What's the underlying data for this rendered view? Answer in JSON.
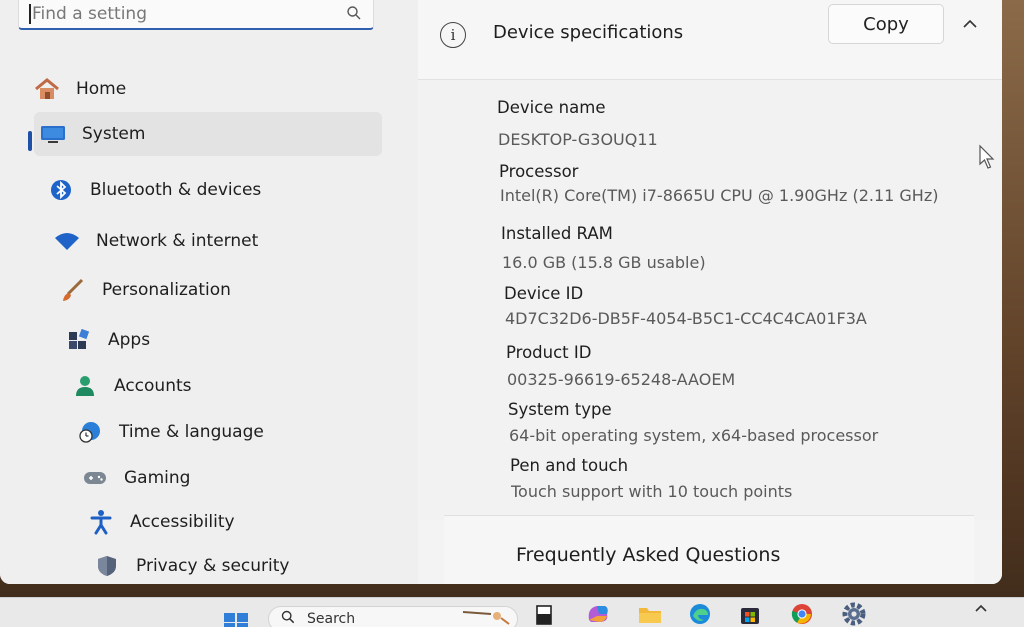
{
  "search": {
    "placeholder": "Find a setting"
  },
  "sidebar": {
    "items": [
      {
        "label": "Home",
        "icon": "home-icon"
      },
      {
        "label": "System",
        "icon": "monitor-icon",
        "active": true
      },
      {
        "label": "Bluetooth & devices",
        "icon": "bluetooth-icon"
      },
      {
        "label": "Network & internet",
        "icon": "wifi-icon"
      },
      {
        "label": "Personalization",
        "icon": "brush-icon"
      },
      {
        "label": "Apps",
        "icon": "apps-icon"
      },
      {
        "label": "Accounts",
        "icon": "person-icon"
      },
      {
        "label": "Time & language",
        "icon": "globe-clock-icon"
      },
      {
        "label": "Gaming",
        "icon": "gamepad-icon"
      },
      {
        "label": "Accessibility",
        "icon": "accessibility-icon"
      },
      {
        "label": "Privacy & security",
        "icon": "shield-icon"
      }
    ]
  },
  "specs": {
    "title": "Device specifications",
    "copy_label": "Copy",
    "rows": [
      {
        "label": "Device name",
        "value": "DESKTOP-G3OUQ11"
      },
      {
        "label": "Processor",
        "value": "Intel(R) Core(TM) i7-8665U CPU @ 1.90GHz (2.11 GHz)"
      },
      {
        "label": "Installed RAM",
        "value": "16.0 GB (15.8 GB usable)"
      },
      {
        "label": "Device ID",
        "value": "4D7C32D6-DB5F-4054-B5C1-CC4C4CA01F3A"
      },
      {
        "label": "Product ID",
        "value": "00325-96619-65248-AAOEM"
      },
      {
        "label": "System type",
        "value": "64-bit operating system, x64-based processor"
      },
      {
        "label": "Pen and touch",
        "value": "Touch support with 10 touch points"
      }
    ]
  },
  "faq": {
    "title": "Frequently Asked Questions"
  },
  "taskbar": {
    "search_label": "Search",
    "apps": [
      "start-icon",
      "file-icon",
      "copilot-icon",
      "file-explorer-icon",
      "edge-icon",
      "store-icon",
      "chrome-icon",
      "settings-icon"
    ]
  },
  "colors": {
    "accent": "#1f4fa6",
    "window_bg": "#eeeeee",
    "taskbar_bg": "#e9e9ea"
  }
}
